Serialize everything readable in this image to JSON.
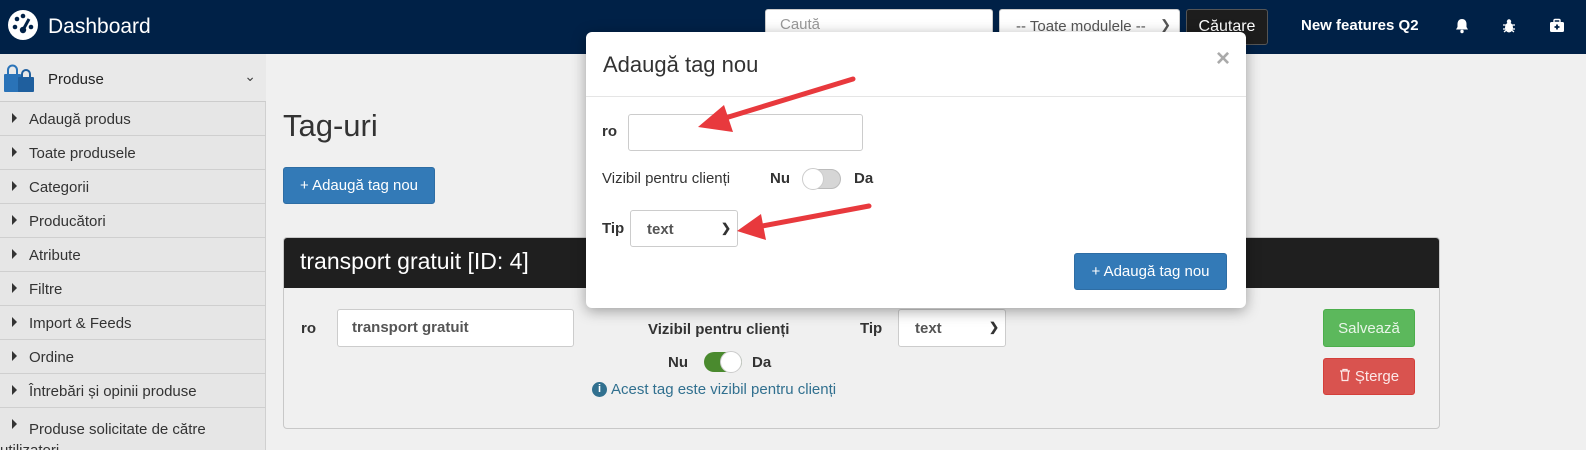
{
  "topbar": {
    "brand": "Dashboard",
    "search_placeholder": "Caută",
    "module_select": "-- Toate modulele --",
    "search_button": "Căutare",
    "features_link": "New features Q2",
    "icons": [
      "bell-icon",
      "bug-icon",
      "medkit-icon"
    ]
  },
  "sidebar": {
    "section": "Produse",
    "items": [
      {
        "label": "Adaugă produs"
      },
      {
        "label": "Toate produsele"
      },
      {
        "label": "Categorii"
      },
      {
        "label": "Producători"
      },
      {
        "label": "Atribute"
      },
      {
        "label": "Filtre"
      },
      {
        "label": "Import & Feeds"
      },
      {
        "label": "Ordine"
      },
      {
        "label": "Întrebări și opinii produse"
      },
      {
        "label": "Produse solicitate de către utilizatori"
      }
    ]
  },
  "main": {
    "title": "Tag-uri",
    "add_button": "+ Adaugă tag nou",
    "card": {
      "header": "transport gratuit [ID: 4]",
      "lang_label": "ro",
      "name_value": "transport gratuit",
      "visible_label": "Vizibil pentru clienți",
      "no": "Nu",
      "yes": "Da",
      "visible_on": true,
      "type_label": "Tip",
      "type_value": "text",
      "note": "Acest tag este vizibil pentru clienți",
      "save": "Salvează",
      "delete": "Șterge"
    }
  },
  "modal": {
    "title": "Adaugă tag nou",
    "close": "×",
    "lang_label": "ro",
    "name_value": "",
    "visible_label": "Vizibil pentru clienți",
    "no": "Nu",
    "yes": "Da",
    "visible_on": false,
    "type_label": "Tip",
    "type_value": "text",
    "submit": "+ Adaugă tag nou"
  },
  "colors": {
    "topbar": "#002147",
    "primary": "#337ab7",
    "success": "#5cb85c",
    "danger": "#d9534f",
    "annotation": "#e8393d"
  }
}
